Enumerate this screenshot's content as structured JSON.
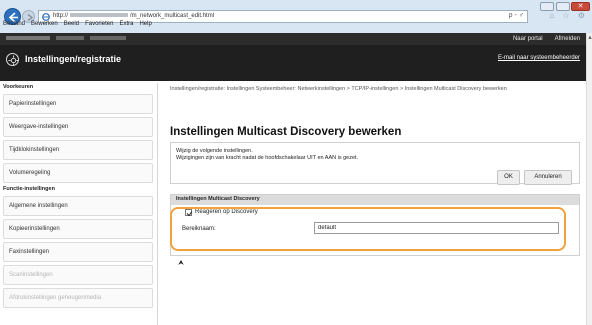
{
  "browser": {
    "url_prefix": "http://",
    "url_suffix": "/m_network_multicast_edit.html",
    "address_tools": "ρ - ♂",
    "toolbar_icons": "⌂ ☆ ⚙",
    "menu": [
      "Bestand",
      "Bewerken",
      "Beeld",
      "Favorieten",
      "Extra",
      "Help"
    ],
    "window_close": "✕"
  },
  "header": {
    "links": [
      "Naar portal",
      "Afmelden"
    ],
    "title": "Instellingen/registratie",
    "esvc_link": "E-mail naar systeembeheerder"
  },
  "sidebar": {
    "groups": [
      {
        "label": "Voorkeuren",
        "items": [
          "Papierinstellingen",
          "Weergave-instellingen",
          "Tijdklokinstellingen",
          "Volumeregeling"
        ]
      },
      {
        "label": "Functie-instellingen",
        "items": [
          "Algemene instellingen",
          "Kopieerinstellingen",
          "Faxinstellingen",
          "Scaninstellingen",
          "Afdrukinstellingen geheugenmedia"
        ]
      }
    ]
  },
  "main": {
    "breadcrumb": "Instellingen/registratie: Instellingen Systeembeheer: Netwerkinstellingen > TCP/IP-instellingen > Instellingen Multicast Discovery bewerken",
    "page_title": "Instellingen Multicast Discovery bewerken",
    "instruction_1": "Wijzig de volgende instellingen.",
    "instruction_2": "Wijzigingen zijn van kracht nadat de hoofdschakelaar UIT en AAN is gezet.",
    "ok_label": "OK",
    "cancel_label": "Annuleren",
    "section_title": "Instellingen Multicast Discovery",
    "checkbox_label": "Reageren op Discovery",
    "checkbox_checked": true,
    "scope_label": "Bereiknaam:",
    "scope_value": "default",
    "top_icon": "⮝"
  },
  "colors": {
    "header_bg": "#2c2c2c",
    "highlight": "#f0a23c",
    "back_button": "#2d6fbf"
  }
}
